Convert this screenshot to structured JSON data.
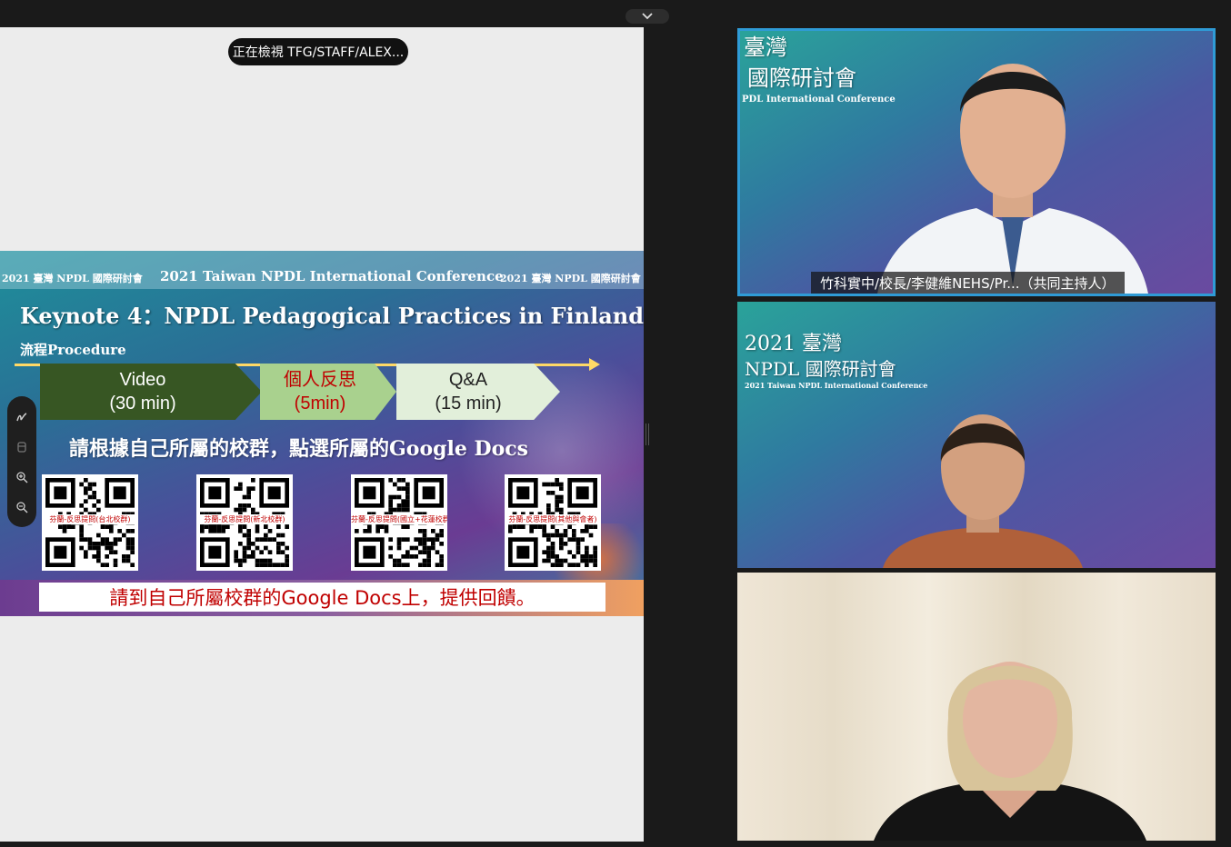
{
  "share_banner": {
    "viewing_text": "正在檢視 TFG/STAFF/ALEX..."
  },
  "slide": {
    "header_left": "2021 臺灣  NPDL 國際研討會",
    "header_mid": "2021 Taiwan NPDL International Conference",
    "header_right": "2021 臺灣  NPDL 國際研討會",
    "title": "Keynote 4：NPDL Pedagogical Practices in Finland",
    "procedure_label": "流程Procedure",
    "steps": [
      {
        "line1": "Video",
        "line2": "(30 min)"
      },
      {
        "line1": "個人反思",
        "line2": "(5min)"
      },
      {
        "line1": "Q&A",
        "line2": "(15 min)"
      }
    ],
    "instruction": "請根據自己所屬的校群，點選所屬的Google Docs",
    "qr_codes": [
      {
        "caption": "芬蘭-反思提問(台北校群)"
      },
      {
        "caption": "芬蘭-反思提問(新北校群)"
      },
      {
        "caption": "芬蘭-反思提問(國立+花蓮校群)"
      },
      {
        "caption": "芬蘭-反思提問(其他與會者)"
      }
    ],
    "banner": "請到自己所屬校群的Google Docs上，提供回饋。"
  },
  "toolbar": {
    "icons": [
      "pen-icon",
      "eraser-icon",
      "zoom-in-icon",
      "zoom-out-icon"
    ]
  },
  "participants": [
    {
      "conf_line1": "臺灣",
      "conf_line2": "國際研討會",
      "conf_line3": "PDL International  Conference",
      "name": "竹科實中/校長/李健維NEHS/Pr...（共同主持人）",
      "active_speaker_color": "#2f9bd6"
    },
    {
      "conf_line1": "2021 臺灣",
      "conf_line2": "NPDL 國際研討會",
      "conf_line3": "2021 Taiwan  NPDL  International  Conference"
    },
    {}
  ],
  "colors": {
    "video_step": "#375623",
    "reflect_step": "#a9d18e",
    "qa_step": "#e2efda",
    "accent_red": "#c00000",
    "timeline": "#ffd966"
  }
}
